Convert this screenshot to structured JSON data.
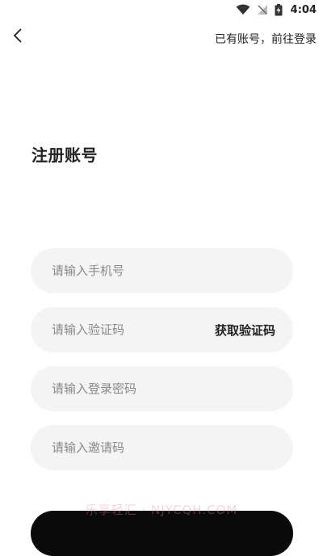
{
  "status_bar": {
    "time": "4:04",
    "icons": [
      "wifi-icon",
      "no-signal-icon",
      "battery-charging-icon"
    ]
  },
  "header": {
    "back_icon": "chevron-left-icon",
    "login_link": "已有账号，前往登录"
  },
  "page": {
    "title": "注册账号"
  },
  "form": {
    "phone_placeholder": "请输入手机号",
    "code_placeholder": "请输入验证码",
    "get_code_label": "获取验证码",
    "password_placeholder": "请输入登录密码",
    "invite_placeholder": "请输入邀请码"
  },
  "watermark": "乐享轻汇 · NJYCQH.COM",
  "colors": {
    "background": "#ffffff",
    "field_bg": "#f4f4f4",
    "primary_button": "#0a0a0a",
    "text": "#222222",
    "placeholder": "#8a8a8a"
  }
}
